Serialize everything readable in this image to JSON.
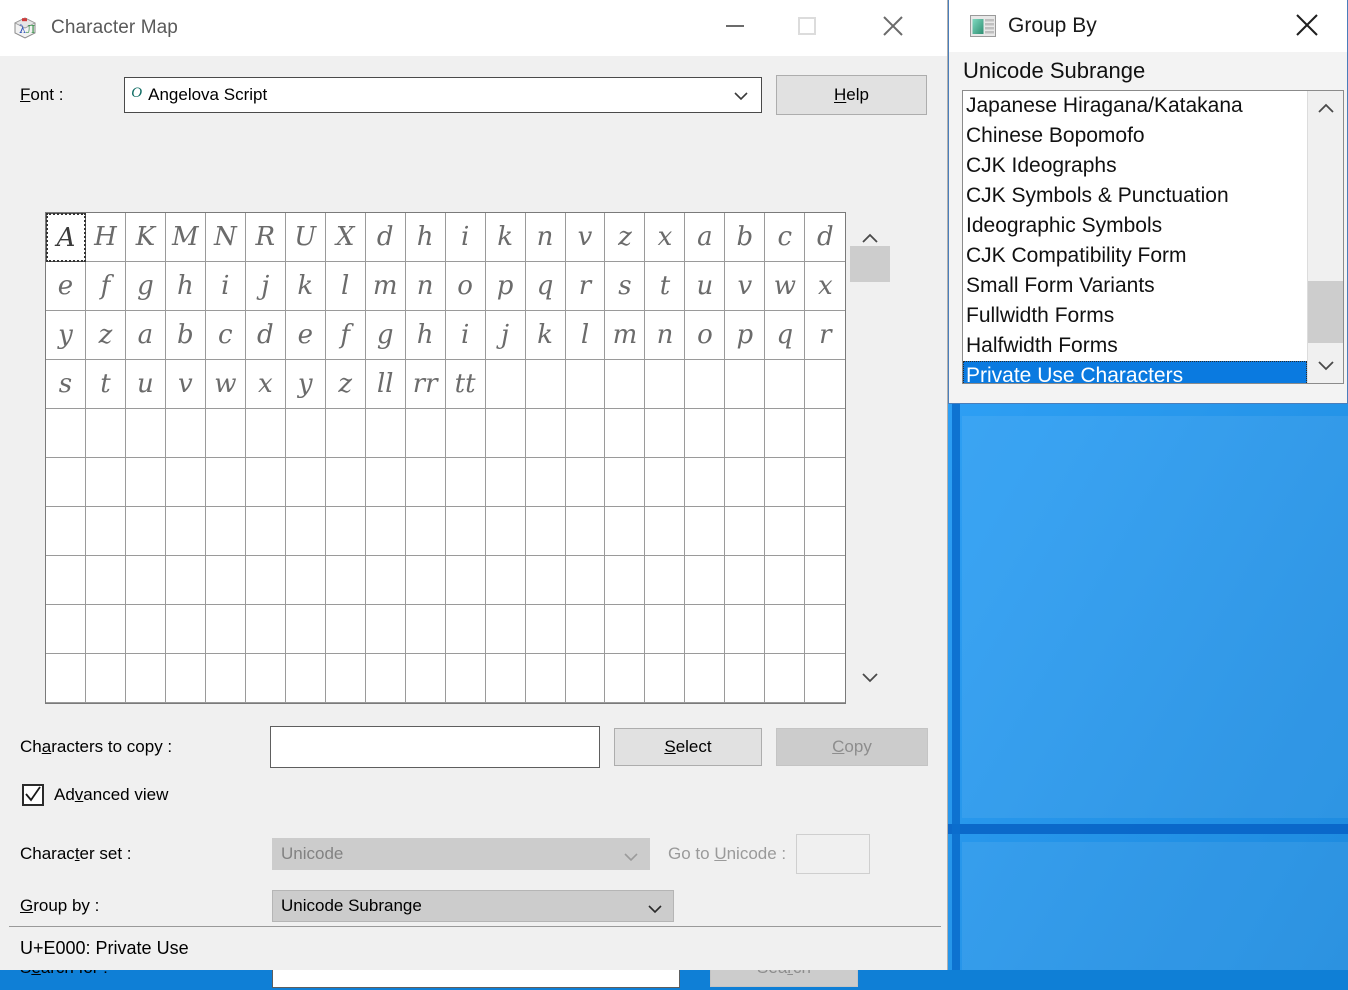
{
  "desktop": {
    "bg_color": "#1f92ec",
    "accent_line_color": "#0a66c8"
  },
  "charmap": {
    "title": "Character Map",
    "app_icon": "character-map-icon",
    "window_buttons": {
      "minimize": "minimize-icon",
      "maximize": "maximize-icon",
      "close": "close-icon"
    },
    "font": {
      "label": "Font :",
      "label_accel": "F",
      "value": "Angelova Script",
      "type_icon": "opentype-icon",
      "dropdown_icon": "chevron-down-icon"
    },
    "help_button": {
      "label": "Help",
      "accel": "H"
    },
    "grid": {
      "columns": 20,
      "rows": 10,
      "selected_index": 0,
      "glyphs": [
        "A",
        "H",
        "K",
        "M",
        "N",
        "R",
        "U",
        "X",
        "d",
        "h",
        "i",
        "k",
        "n",
        "v",
        "z",
        "x",
        "a",
        "b",
        "c",
        "d",
        "e",
        "f",
        "g",
        "h",
        "i",
        "j",
        "k",
        "l",
        "m",
        "n",
        "o",
        "p",
        "q",
        "r",
        "s",
        "t",
        "u",
        "v",
        "w",
        "x",
        "y",
        "z",
        "a",
        "b",
        "c",
        "d",
        "e",
        "f",
        "g",
        "h",
        "i",
        "j",
        "k",
        "l",
        "m",
        "n",
        "o",
        "p",
        "q",
        "r",
        "s",
        "t",
        "u",
        "v",
        "w",
        "x",
        "y",
        "z",
        "ll",
        "rr",
        "tt"
      ],
      "scrollbar": {
        "up_icon": "chevron-up-icon",
        "down_icon": "chevron-down-icon"
      }
    },
    "characters_to_copy": {
      "label": "Characters to copy :",
      "label_accel": "a",
      "value": "",
      "placeholder": ""
    },
    "select_button": {
      "label": "Select",
      "accel": "S",
      "enabled": true
    },
    "copy_button": {
      "label": "Copy",
      "accel": "C",
      "enabled": false
    },
    "advanced_view": {
      "label": "Advanced view",
      "accel": "v",
      "checked": true
    },
    "character_set": {
      "label": "Character set :",
      "label_accel": "t",
      "value": "Unicode",
      "enabled": false
    },
    "go_to_unicode": {
      "label": "Go to Unicode :",
      "label_accel": "U",
      "value": "",
      "enabled": false
    },
    "group_by": {
      "label": "Group by :",
      "label_accel": "G",
      "value": "Unicode Subrange",
      "enabled": true
    },
    "search_for": {
      "label": "Search for :",
      "label_accel": "e",
      "value": "",
      "placeholder": ""
    },
    "search_button": {
      "label": "Search",
      "accel": "r",
      "enabled": false
    },
    "status": "U+E000: Private Use"
  },
  "groupby_window": {
    "title": "Group By",
    "icon": "window-list-icon",
    "close_icon": "close-icon",
    "heading": "Unicode Subrange",
    "items": [
      {
        "label": "Japanese Hiragana/Katakana",
        "selected": false
      },
      {
        "label": "Chinese Bopomofo",
        "selected": false
      },
      {
        "label": "CJK Ideographs",
        "selected": false
      },
      {
        "label": "CJK Symbols & Punctuation",
        "selected": false
      },
      {
        "label": "Ideographic Symbols",
        "selected": false
      },
      {
        "label": "CJK Compatibility Form",
        "selected": false
      },
      {
        "label": "Small Form Variants",
        "selected": false
      },
      {
        "label": "Fullwidth Forms",
        "selected": false
      },
      {
        "label": "Halfwidth Forms",
        "selected": false
      },
      {
        "label": "Private Use Characters",
        "selected": true
      }
    ],
    "scrollbar": {
      "up_icon": "chevron-up-icon",
      "down_icon": "chevron-down-icon"
    }
  }
}
